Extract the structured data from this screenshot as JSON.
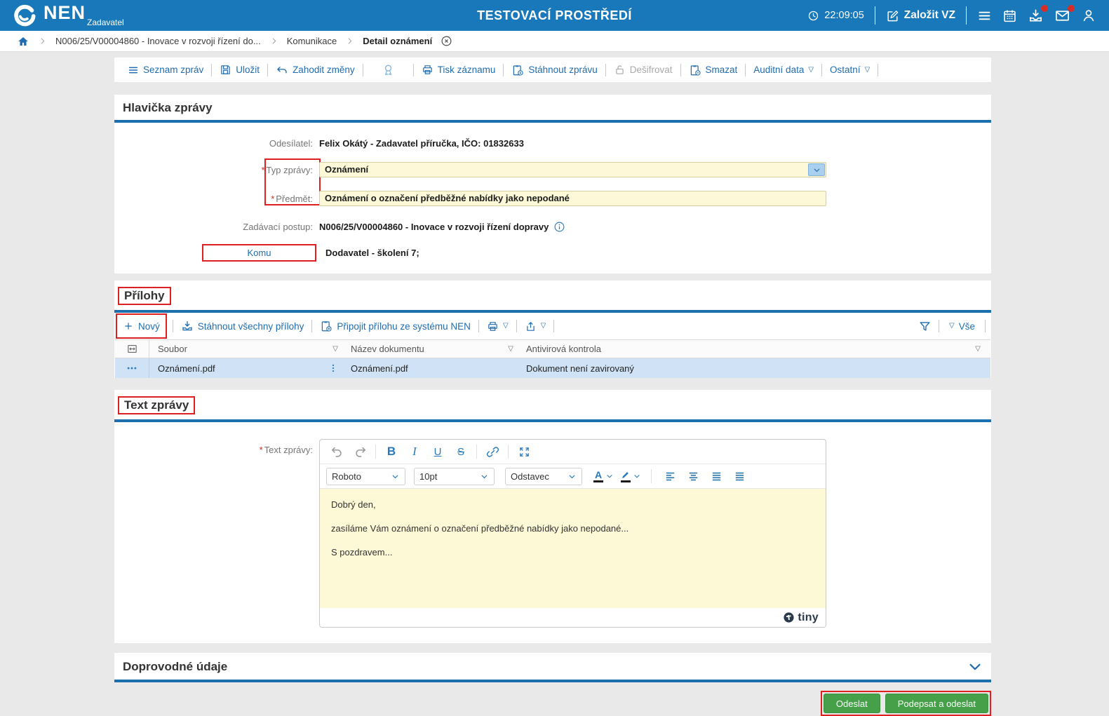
{
  "topbar": {
    "logo": "NEN",
    "logo_sub": "Zadavatel",
    "env_title": "TESTOVACÍ PROSTŘEDÍ",
    "time": "22:09:05",
    "new_vz_label": "Založit VZ"
  },
  "breadcrumb": {
    "items": [
      {
        "label": "N006/25/V00004860 - Inovace v rozvoji řízení do..."
      },
      {
        "label": "Komunikace"
      },
      {
        "label": "Detail oznámení"
      }
    ]
  },
  "toolbar": {
    "list": "Seznam zpráv",
    "save": "Uložit",
    "discard": "Zahodit změny",
    "print": "Tisk záznamu",
    "download": "Stáhnout zprávu",
    "decrypt": "Dešifrovat",
    "delete": "Smazat",
    "audit": "Auditní data",
    "other": "Ostatní",
    "dropdown_mark": "▽"
  },
  "message_header": {
    "title": "Hlavička zprávy",
    "required_mark": "*",
    "sender_label": "Odesílatel:",
    "sender_value": "Felix Okátý - Zadavatel příručka, IČO: 01832633",
    "type_label": "Typ zprávy:",
    "type_value": "Oznámení",
    "subject_label": "Předmět:",
    "subject_value": "Oznámení o označení předběžné nabídky jako nepodané",
    "procedure_label": "Zadávací postup:",
    "procedure_value": "N006/25/V00004860 - Inovace v rozvoji řízení dopravy",
    "to_label": "Komu",
    "to_value": "Dodavatel - školení 7;"
  },
  "attachments": {
    "title": "Přílohy",
    "new_label": "Nový",
    "download_all_label": "Stáhnout všechny přílohy",
    "attach_from_nen_label": "Připojit přílohu ze systému NEN",
    "filter_all_label": "Vše",
    "dropdown_mark": "▽",
    "columns": [
      "Soubor",
      "Název dokumentu",
      "Antivirová kontrola"
    ],
    "rows": [
      {
        "file": "Oznámení.pdf",
        "doc_name": "Oznámení.pdf",
        "antivirus": "Dokument není zavirovaný"
      }
    ]
  },
  "message_text": {
    "title": "Text zprávy",
    "required_mark": "*",
    "label": "Text zprávy:",
    "editor": {
      "font_family": "Roboto",
      "font_size": "10pt",
      "block_format": "Odstavec",
      "bold_glyph": "B",
      "italic_glyph": "I",
      "underline_glyph": "U",
      "strike_glyph": "S",
      "color_letter": "A",
      "paragraphs": [
        "Dobrý den,",
        "zasíláme Vám oznámení o označení předběžné nabídky jako nepodané...",
        "S pozdravem..."
      ],
      "brand": "tiny"
    }
  },
  "accompanying": {
    "title": "Doprovodné údaje"
  },
  "footer": {
    "send_label": "Odeslat",
    "sign_and_send_label": "Podepsat a odeslat"
  }
}
